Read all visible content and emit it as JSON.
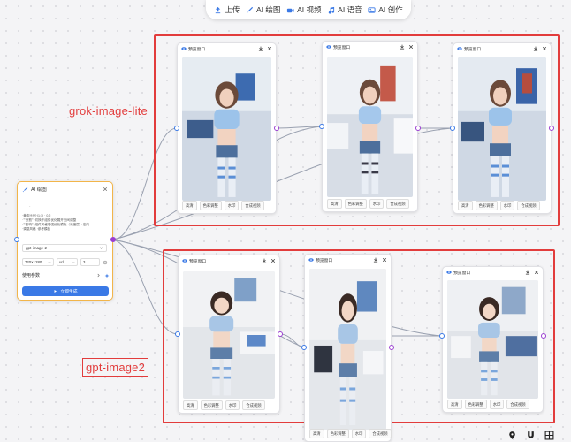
{
  "toolbar": {
    "upload": "上传",
    "ai_draw": "AI 绘图",
    "ai_video": "AI 视频",
    "ai_audio": "AI 语音",
    "ai_create": "AI 创作"
  },
  "groups": {
    "top_label": "grok-image-lite",
    "bottom_label": "gpt-image2"
  },
  "card": {
    "title": "预览窗口",
    "actions": [
      "高清",
      "色彩调整",
      "水印",
      "合成视频"
    ]
  },
  "node": {
    "title": "AI 绘图",
    "prompt_lines": [
      "·",
      "·黄金比例·(1:1) · 0.2",
      "·\"\"分割\"\" 切换下组件优化展开空间调整",
      "·\"\"影响\"\" 组件风格增强优化模板（深度层）· 定向",
      "·调整风格  ·参考模板"
    ],
    "model": "gpt-image-2",
    "size": "720×1280",
    "ratio": "url",
    "count": "3",
    "params_label": "使用参数",
    "generate": "立即生成"
  },
  "colors": {
    "accent": "#3a79e6",
    "group_border": "#e23c3c",
    "node_border": "#f2b54a",
    "port_out": "#9b3fd1"
  }
}
